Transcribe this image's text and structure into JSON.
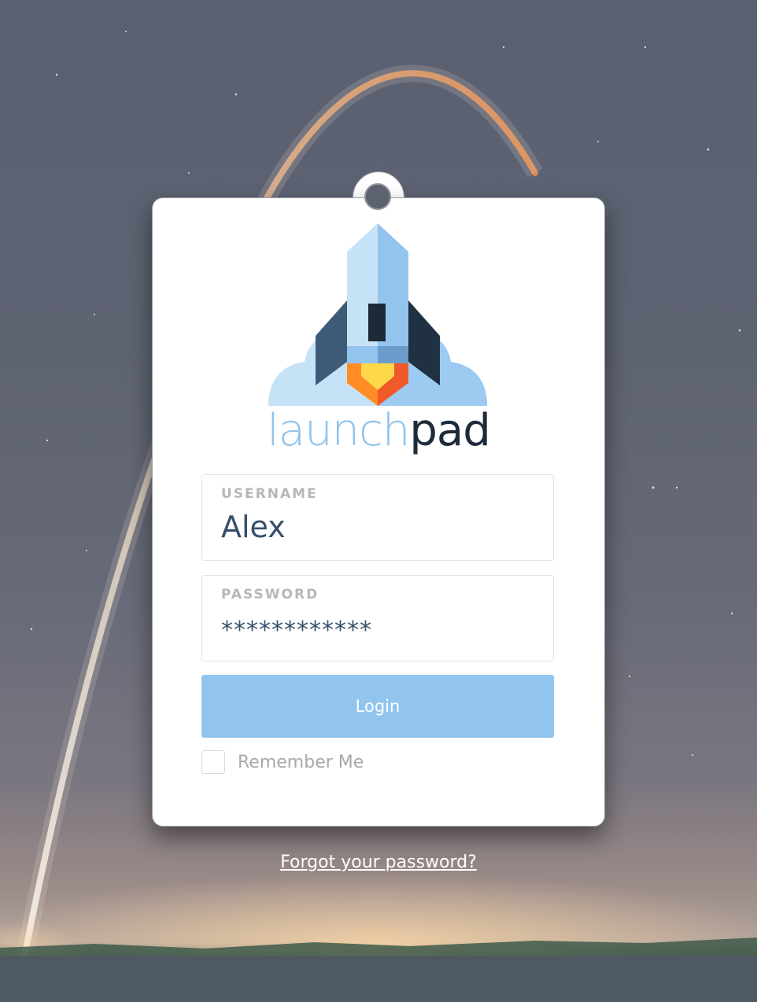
{
  "app": {
    "brand_part1": "launch",
    "brand_part2": "pad"
  },
  "form": {
    "username_label": "USERNAME",
    "username_value": "Alex",
    "password_label": "PASSWORD",
    "password_value": "************",
    "login_label": "Login",
    "remember_label": "Remember Me",
    "remember_checked": false
  },
  "links": {
    "forgot_label": "Forgot your password?"
  },
  "icons": {
    "logo": "rocket-logo-icon"
  },
  "colors": {
    "accent": "#92c5ee",
    "brand_light": "#8fc3ec",
    "brand_dark": "#1d2b3a",
    "input_text": "#35506b"
  }
}
